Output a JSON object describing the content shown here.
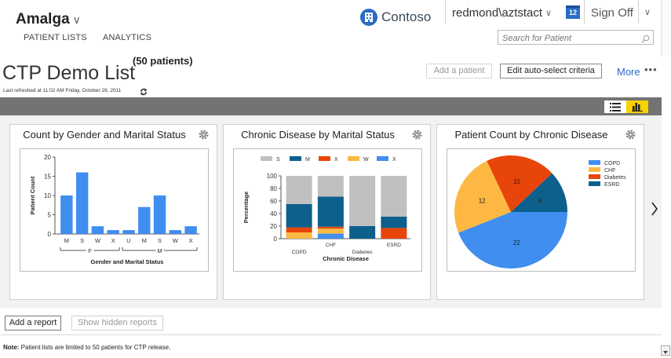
{
  "header": {
    "app_name": "Amalga",
    "app_chevron": "∨",
    "nav": {
      "patient_lists": "PATIENT LISTS",
      "analytics": "ANALYTICS"
    },
    "brand": "Contoso",
    "user": "redmond\\aztstact",
    "user_chevron": "∨",
    "calendar_badge": "12",
    "sign_off": "Sign Off",
    "menu_chevron": "∨",
    "search": {
      "placeholder": "Search for Patient"
    }
  },
  "list": {
    "title": "CTP Demo List",
    "count": "(50 patients)",
    "refreshed": "Last refreshed at 11:02 AM Friday, October 28, 2011",
    "add_patient": "Add a patient",
    "edit_criteria": "Edit auto-select criteria",
    "more": "More",
    "more_dots": "•••"
  },
  "panels": [
    {
      "title": "Count by Gender and Marital Status"
    },
    {
      "title": "Chronic Disease by Marital Status"
    },
    {
      "title": "Patient Count by Chronic Disease"
    }
  ],
  "footer": {
    "add_report": "Add a report",
    "show_hidden": "Show hidden reports",
    "note_label": "Note:",
    "note_text": " Patient lists are limited to 50 patients for CTP release."
  },
  "colors": {
    "accent_blue": "#3f8ef0",
    "navy": "#0d5f8c",
    "orange": "#e8450a",
    "yellow": "#fdb843",
    "gray": "#c0c0c0",
    "toolbar_band": "#737373",
    "toggle_active": "#f7d200"
  },
  "chart_data": [
    {
      "type": "bar",
      "title": "Count by Gender and Marital Status",
      "xlabel": "Gender and Marital Status",
      "ylabel": "Patient Count",
      "categories": [
        "M",
        "S",
        "W",
        "X",
        "U",
        "M",
        "S",
        "W",
        "X"
      ],
      "groups": [
        {
          "name": "F",
          "categories": [
            "M",
            "S",
            "W",
            "X"
          ]
        },
        {
          "name": "M",
          "categories": [
            "U",
            "M",
            "S",
            "W",
            "X"
          ]
        }
      ],
      "values": [
        10,
        16,
        2,
        1,
        1,
        7,
        10,
        1,
        2
      ],
      "ylim": [
        0,
        20
      ],
      "yticks": [
        0,
        5,
        10,
        15,
        20
      ],
      "color": "#3f8ef0",
      "grid": false
    },
    {
      "type": "bar",
      "stacked": true,
      "title": "Chronic Disease by Marital Status",
      "xlabel": "Chronic Disease",
      "ylabel": "Percentage",
      "categories": [
        "COPD",
        "CHF",
        "Diabetes",
        "ESRD"
      ],
      "legend_position": "top",
      "ylim": [
        0,
        100
      ],
      "yticks": [
        0,
        20,
        40,
        60,
        80,
        100
      ],
      "series": [
        {
          "name": "X",
          "color": "#3f8ef0",
          "values": [
            0,
            8,
            0,
            0
          ]
        },
        {
          "name": "W",
          "color": "#fdb843",
          "values": [
            10,
            8,
            0,
            0
          ]
        },
        {
          "name": "X",
          "color": "#e8450a",
          "values": [
            8,
            3,
            0,
            17
          ]
        },
        {
          "name": "M",
          "color": "#0d5f8c",
          "values": [
            37,
            48,
            20,
            18
          ]
        },
        {
          "name": "S",
          "color": "#c0c0c0",
          "values": [
            45,
            33,
            80,
            65
          ]
        }
      ],
      "legend": [
        {
          "name": "S",
          "color": "#c0c0c0"
        },
        {
          "name": "M",
          "color": "#0d5f8c"
        },
        {
          "name": "X",
          "color": "#e8450a"
        },
        {
          "name": "W",
          "color": "#fdb843"
        },
        {
          "name": "X",
          "color": "#3f8ef0"
        }
      ]
    },
    {
      "type": "pie",
      "title": "Patient Count by Chronic Disease",
      "legend_position": "right",
      "slices": [
        {
          "label": "COPD",
          "value": 22,
          "color": "#3f8ef0"
        },
        {
          "label": "CHF",
          "value": 12,
          "color": "#fdb843"
        },
        {
          "label": "Diabetes",
          "value": 10,
          "color": "#e8450a"
        },
        {
          "label": "ESRD",
          "value": 6,
          "color": "#0d5f8c"
        }
      ]
    }
  ]
}
